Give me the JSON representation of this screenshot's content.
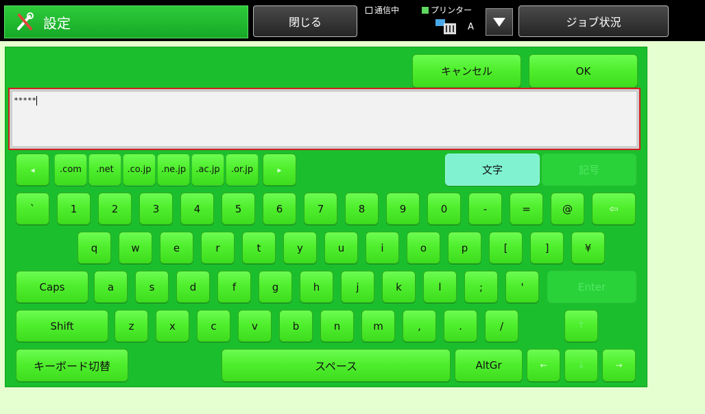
{
  "header": {
    "title": "設定",
    "close_label": "閉じる",
    "job_status_label": "ジョブ状況",
    "status_comm": "通信中",
    "status_printer": "プリンター",
    "status_a": "A"
  },
  "keyboard": {
    "cancel_label": "キャンセル",
    "ok_label": "OK",
    "input_value": "*****",
    "mode_chars": "文字",
    "mode_symbols": "記号",
    "domain_prev": "◂",
    "domain_next": "▸",
    "domains": [
      ".com",
      ".net",
      ".co.jp",
      ".ne.jp",
      ".ac.jp",
      ".or.jp"
    ],
    "row1": [
      "`",
      "1",
      "2",
      "3",
      "4",
      "5",
      "6",
      "7",
      "8",
      "9",
      "0",
      "-",
      "=",
      "@"
    ],
    "backspace": "⇦",
    "row2": [
      "q",
      "w",
      "e",
      "r",
      "t",
      "y",
      "u",
      "i",
      "o",
      "p",
      "[",
      "]",
      "¥"
    ],
    "caps_label": "Caps",
    "row3": [
      "a",
      "s",
      "d",
      "f",
      "g",
      "h",
      "j",
      "k",
      "l",
      ";",
      "'"
    ],
    "enter_label": "Enter",
    "shift_label": "Shift",
    "row4": [
      "z",
      "x",
      "c",
      "v",
      "b",
      "n",
      "m",
      ",",
      ".",
      "/"
    ],
    "arrow_up": "↑",
    "kb_switch_label": "キーボード切替",
    "space_label": "スペース",
    "altgr_label": "AltGr",
    "arrow_left": "←",
    "arrow_down": "↓",
    "arrow_right": "→"
  }
}
